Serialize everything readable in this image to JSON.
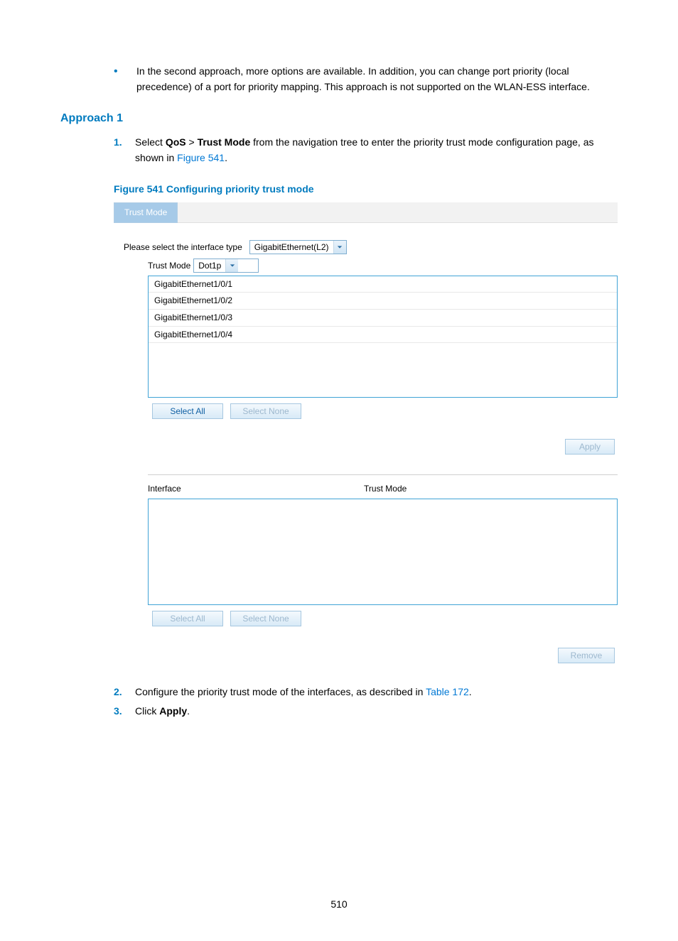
{
  "bullet": "In the second approach, more options are available. In addition, you can change port priority (local precedence) of a port for priority mapping. This approach is not supported on the WLAN-ESS interface.",
  "approach1_heading": "Approach 1",
  "steps": {
    "s1_prefix": "Select ",
    "s1_bold1": "QoS",
    "s1_sep": " > ",
    "s1_bold2": "Trust Mode",
    "s1_suffix1": " from the navigation tree to enter the priority trust mode configuration page, as shown in ",
    "s1_link": "Figure 541",
    "s1_end": ".",
    "s2_prefix": "Configure the priority trust mode of the interfaces, as described in ",
    "s2_link": "Table 172",
    "s2_end": ".",
    "s3_prefix": "Click ",
    "s3_bold": "Apply",
    "s3_end": "."
  },
  "figure_caption": "Figure 541 Configuring priority trust mode",
  "figure": {
    "tab_label": "Trust Mode",
    "interface_type_label": "Please select the interface type",
    "interface_type_value": "GigabitEthernet(L2)",
    "trust_mode_label": "Trust Mode",
    "trust_mode_value": "Dot1p",
    "interfaces": [
      "GigabitEthernet1/0/1",
      "GigabitEthernet1/0/2",
      "GigabitEthernet1/0/3",
      "GigabitEthernet1/0/4"
    ],
    "buttons": {
      "select_all": "Select All",
      "select_none": "Select None",
      "apply": "Apply",
      "remove": "Remove"
    },
    "table": {
      "col_interface": "Interface",
      "col_trustmode": "Trust Mode"
    }
  },
  "page_number": "510"
}
